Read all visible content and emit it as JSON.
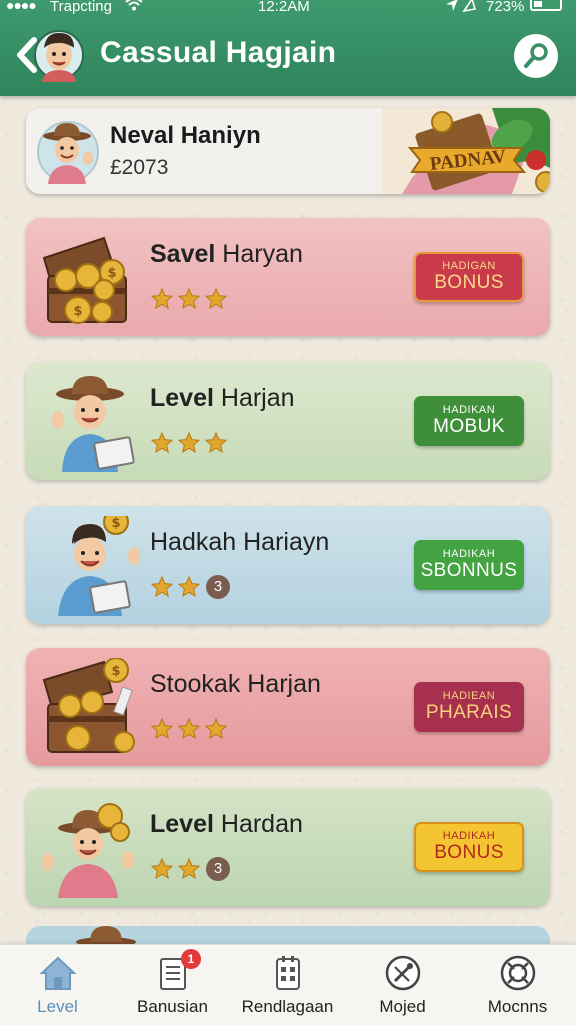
{
  "status_bar": {
    "carrier": "Trapcting",
    "time": "12:2AM",
    "battery": "723%",
    "icons": [
      "signal-dots-icon",
      "wifi-icon",
      "location-icon",
      "battery-icon"
    ]
  },
  "header": {
    "title": "Cassual Hagjain",
    "back_icon": "chevron-left-icon",
    "search_icon": "search-icon",
    "color": "#3a9066"
  },
  "profile": {
    "name": "Neval Haniyn",
    "score": "£2073",
    "banner_label": "PADNAV"
  },
  "levels": [
    {
      "name_bold": "Savel",
      "name_rest": " Haryan",
      "stars": 3,
      "badge": "",
      "button_line1": "HADIGAN",
      "button_line2": "BONUS",
      "button_color": "#c93a4b",
      "art": "treasure-chest"
    },
    {
      "name_bold": "Level",
      "name_rest": " Harjan",
      "stars": 3,
      "badge": "",
      "button_line1": "HADIKAN",
      "button_line2": "MOBUK",
      "button_color": "#3f8f3a",
      "art": "explorer-boy"
    },
    {
      "name_bold": "",
      "name_rest": "Hadkah Hariayn",
      "stars": 2,
      "badge": "3",
      "button_line1": "HADIKAH",
      "button_line2": "SBONNUS",
      "button_color": "#43a343",
      "art": "explorer-boy-coin"
    },
    {
      "name_bold": "",
      "name_rest": "Stookak Harjan",
      "stars": 3,
      "badge": "",
      "button_line1": "HADIEAN",
      "button_line2": "PHARAIS",
      "button_color": "#a8304f",
      "art": "treasure-chest"
    },
    {
      "name_bold": "Level",
      "name_rest": " Hardan",
      "stars": 2,
      "badge": "3",
      "button_line1": "HADIKAH",
      "button_line2": "BONUS",
      "button_color": "#f2c531",
      "art": "explorer-boy-coins"
    }
  ],
  "tabs": [
    {
      "label": "Level",
      "icon": "home-icon",
      "active": true
    },
    {
      "label": "Banusian",
      "icon": "document-list-icon",
      "badge": "1"
    },
    {
      "label": "Rendlagaan",
      "icon": "calendar-grid-icon"
    },
    {
      "label": "Mojed",
      "icon": "tools-icon"
    },
    {
      "label": "Mocnns",
      "icon": "target-icon"
    }
  ]
}
